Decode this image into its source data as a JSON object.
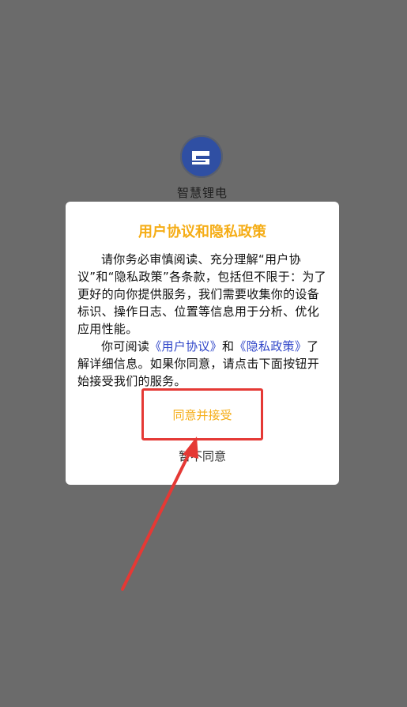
{
  "app": {
    "name": "智慧锂电",
    "logo_icon": "s-logo-icon"
  },
  "dialog": {
    "title": "用户协议和隐私政策",
    "para1": "请你务必审慎阅读、充分理解“用户协议”和“隐私政策”各条款，包括但不限于：为了更好的向你提供服务，我们需要收集你的设备标识、操作日志、位置等信息用于分析、优化应用性能。",
    "para2_prefix": "你可阅读",
    "user_agreement_link": "《用户协议》",
    "para2_and": "和",
    "privacy_policy_link": "《隐私政策》",
    "para2_suffix": "了解详细信息。如果你同意，请点击下面按钮开始接受我们的服务。",
    "accept_label": "同意并接受",
    "decline_label": "暂不同意"
  },
  "colors": {
    "overlay": "#6b6b6b",
    "accent": "#f5ad16",
    "link": "#2f45c8",
    "annotation": "#e53935"
  },
  "annotations": {
    "highlight_box": "red-highlight-box",
    "arrow": "red-arrow-annotation"
  }
}
